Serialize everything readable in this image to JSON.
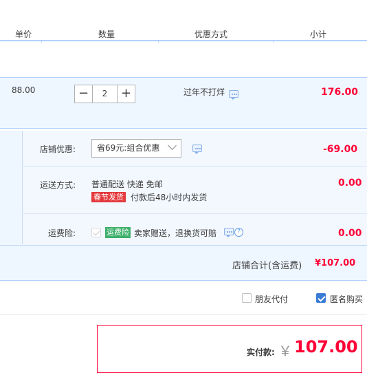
{
  "header": {
    "unit_price": "单价",
    "quantity": "数量",
    "discount_method": "优惠方式",
    "subtotal": "小计"
  },
  "item": {
    "price": "88.00",
    "quantity": "2",
    "minus": "−",
    "plus": "+",
    "promo": "过年不打烊",
    "subtotal": "176.00"
  },
  "shop_discount": {
    "label": "店铺优惠:",
    "selected": "省69元:组合优惠",
    "amount": "-69.00"
  },
  "shipping": {
    "label": "运送方式:",
    "method": "普通配送 快递 免邮",
    "badge": "春节发货",
    "note": "付款后48小时内发货",
    "amount": "0.00"
  },
  "insurance": {
    "label": "运费险:",
    "badge": "运费险",
    "text": "卖家赠送，退换货可赔",
    "amount": "0.00"
  },
  "shop_total": {
    "label": "店铺合计(含运费)",
    "amount": "¥107.00"
  },
  "options": {
    "friend_pay": "朋友代付",
    "anonymous": "匿名购买"
  },
  "payment": {
    "label": "实付款:",
    "currency": "￥",
    "amount": "107.00"
  },
  "colors": {
    "accent_red": "#ff0036",
    "border_blue": "#b2d1ff",
    "panel_blue": "#eef6ff",
    "checkbox_blue": "#3a7bd5",
    "tag_green": "#3db06b",
    "tag_red": "#e4393c"
  }
}
